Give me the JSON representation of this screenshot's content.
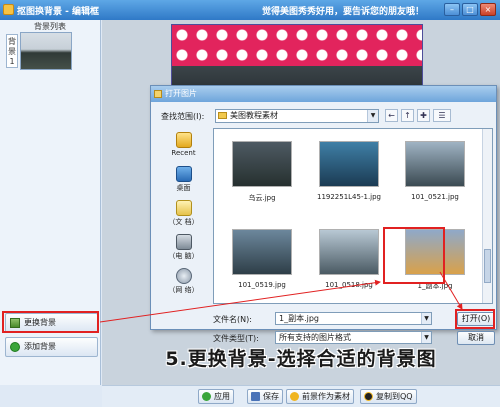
{
  "window": {
    "title": "抠图换背景 - 编辑框",
    "slogan": "觉得美图秀秀好用，要告诉您的朋友哦！",
    "min_glyph": "–",
    "max_glyph": "□",
    "close_glyph": "×"
  },
  "sidebar": {
    "header": "背景列表",
    "tab_label": "背景1",
    "change_bg_label": "更换背景",
    "add_bg_label": "添加背景"
  },
  "dialog": {
    "title": "打开图片",
    "look_in_label": "查找范围(I):",
    "look_in_value": "美图教程素材",
    "places": [
      {
        "label": "Recent",
        "icon": "recent-folder-icon"
      },
      {
        "label": "桌面",
        "icon": "desktop-icon"
      },
      {
        "label": "（文 档）",
        "icon": "documents-icon"
      },
      {
        "label": "（电 脑）",
        "icon": "computer-icon"
      },
      {
        "label": "（网 络）",
        "icon": "network-icon"
      }
    ],
    "files": [
      {
        "name": "乌云.jpg",
        "thumb_top": "#4e5a63",
        "thumb_bottom": "#26302f"
      },
      {
        "name": "1192251L45-1.jpg",
        "thumb_top": "#3f7fa6",
        "thumb_bottom": "#1b3b53"
      },
      {
        "name": "101_0521.jpg",
        "thumb_top": "#9fb3c3",
        "thumb_bottom": "#3b4a52"
      },
      {
        "name": "101_0519.jpg",
        "thumb_top": "#6c879c",
        "thumb_bottom": "#2e3e47"
      },
      {
        "name": "101_0518.jpg",
        "thumb_top": "#b8c8d4",
        "thumb_bottom": "#4a5a63"
      },
      {
        "name": "1_副本.jpg",
        "thumb_top": "#8fa9c9",
        "thumb_bottom": "#d9a14a"
      }
    ],
    "file_name_label": "文件名(N):",
    "file_name_value": "1_副本.jpg",
    "file_type_label": "文件类型(T):",
    "file_type_value": "所有支持的图片格式",
    "open_label": "打开(O)",
    "cancel_label": "取消"
  },
  "caption": "5.更换背景-选择合适的背景图",
  "footer": {
    "apply_label": "应用",
    "save_label": "保存",
    "save_as_material_label": "前景作为素材",
    "copy_qq_label": "复制到QQ"
  },
  "colors": {
    "highlight": "#e12121",
    "title_bar": "#2f79c7",
    "photo_bg": "#e2245d"
  }
}
